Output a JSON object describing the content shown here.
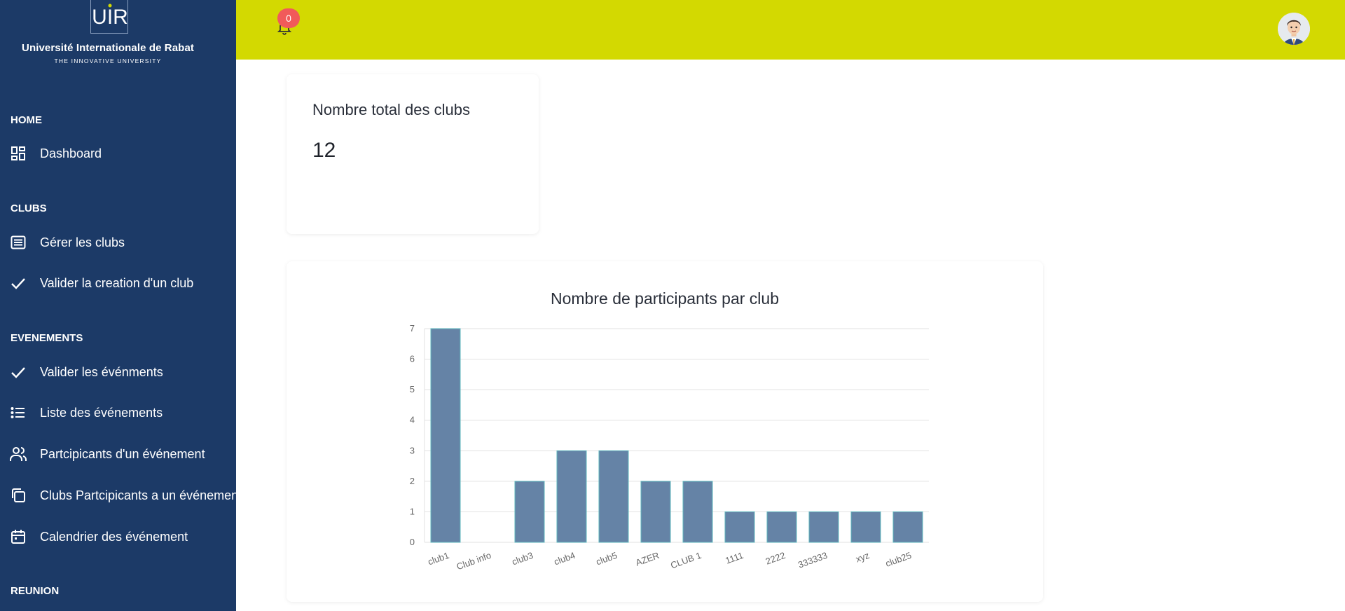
{
  "sidebar": {
    "logo_text": "UIR",
    "university_name": "Université Internationale de Rabat",
    "tagline": "THE INNOVATIVE UNIVERSITY",
    "sections": {
      "home": "HOME",
      "clubs": "CLUBS",
      "events": "EVENEMENTS",
      "meeting": "REUNION"
    },
    "items": {
      "dashboard": "Dashboard",
      "manage_clubs": "Gérer les clubs",
      "validate_club": "Valider la creation d'un club",
      "validate_events": "Valider les événments",
      "event_list": "Liste des événements",
      "event_participants": "Partcipicants d'un événement",
      "club_participants": "Clubs Partcipicants a un événement",
      "calendar": "Calendrier des événement"
    }
  },
  "header": {
    "notification_count": "0"
  },
  "stats_card": {
    "title": "Nombre total des clubs",
    "value": "12"
  },
  "colors": {
    "sidebar_bg": "#1c3a67",
    "topbar_bg": "#d3d901",
    "bar_fill": "#6583a6",
    "bar_stroke": "#5fb8bf",
    "badge": "#f15a5a"
  },
  "chart_data": {
    "type": "bar",
    "title": "Nombre de participants par club",
    "categories": [
      "club1",
      "Club info",
      "club3",
      "club4",
      "club5",
      "AZER",
      "CLUB 1",
      "1111",
      "2222",
      "333333",
      "xyz",
      "club25"
    ],
    "values": [
      7,
      0,
      2,
      3,
      3,
      2,
      2,
      1,
      1,
      1,
      1,
      1
    ],
    "ylim": [
      0,
      7
    ],
    "yticks": [
      0,
      1,
      2,
      3,
      4,
      5,
      6,
      7
    ],
    "grid": true,
    "legend": "none"
  }
}
